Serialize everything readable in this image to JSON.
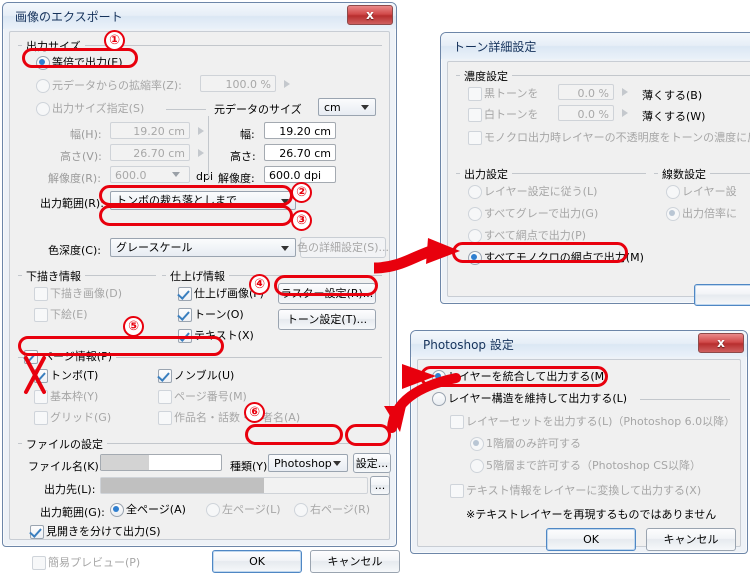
{
  "colors": {
    "annotation_red": "#e8000d",
    "title_text": "#15325b",
    "dialog_bg": "#f0f0f0",
    "accent_blue": "#2f7fd0"
  },
  "export_dialog": {
    "title": "画像のエクスポート",
    "close_label": "x",
    "output_size": {
      "group_label": "出力サイズ",
      "radio_actual": "等倍で出力(E)",
      "radio_scale": "元データからの拡縮率(Z):",
      "scale_value": "100.0 %",
      "radio_specify": "出力サイズ指定(S)",
      "width_label": "幅(H):",
      "width_value": "19.20 cm",
      "height_label": "高さ(V):",
      "height_value": "26.70 cm",
      "res_label": "解像度(R):",
      "res_value": "600.0",
      "res_unit": "dpi",
      "source_size_label": "元データのサイズ",
      "unit_value": "cm",
      "src_width_label": "幅:",
      "src_width_value": "19.20 cm",
      "src_height_label": "高さ:",
      "src_height_value": "26.70 cm",
      "src_res_label": "解像度:",
      "src_res_value": "600.0 dpi",
      "range_label": "出力範囲(R):",
      "range_value": "トンボの裁ち落としまで",
      "depth_label": "色深度(C):",
      "depth_value": "グレースケール",
      "color_detail_button": "色の詳細設定(S)..."
    },
    "draft_info": {
      "group_label": "下描き情報",
      "check_draft_image": "下描き画像(D)",
      "check_sketch": "下絵(E)"
    },
    "finish_info": {
      "group_label": "仕上げ情報",
      "check_finish_image": "仕上げ画像(F)",
      "check_tone": "トーン(O)",
      "check_text": "テキスト(X)",
      "raster_button": "ラスター設定(R)...",
      "tone_button": "トーン設定(T)..."
    },
    "page_info": {
      "group_label": "ページ情報(P)",
      "check_tombo": "トンボ(T)",
      "check_nonbre": "ノンブル(U)",
      "check_basic_frame": "基本枠(Y)",
      "check_page_number": "ページ番号(M)",
      "check_grid": "グリッド(G)",
      "check_title_author": "作品名・話数・作者名(A)"
    },
    "file_settings": {
      "group_label": "ファイルの設定",
      "filename_label": "ファイル名(K):",
      "filename_value": "",
      "type_label": "種類(Y):",
      "type_value": "Photoshop",
      "settings_button": "設定...",
      "dest_label": "出力先(L):",
      "dest_value": "",
      "browse_button": "...",
      "range_label": "出力範囲(G):",
      "radio_all_pages": "全ページ(A)",
      "radio_left_page": "左ページ(L)",
      "radio_right_page": "右ページ(R)",
      "check_split_spread": "見開きを分けて出力(S)"
    },
    "footer": {
      "check_simple_preview": "簡易プレビュー(P)",
      "ok_button": "OK",
      "cancel_button": "キャンセル"
    }
  },
  "tone_dialog": {
    "title": "トーン詳細設定",
    "density": {
      "group_label": "濃度設定",
      "check_black_tone": "黒トーンを",
      "black_value": "0.0 %",
      "black_suffix": "薄くする(B)",
      "check_white_tone": "白トーンを",
      "white_value": "0.0 %",
      "white_suffix": "薄くする(W)",
      "check_mono_opacity": "モノクロ出力時レイヤーの不透明度をトーンの濃度に反映"
    },
    "output": {
      "group_label": "出力設定",
      "radio_follow_layer": "レイヤー設定に従う(L)",
      "radio_all_gray": "すべてグレーで出力(G)",
      "radio_all_halftone": "すべて網点で出力(P)",
      "radio_all_mono_halftone": "すべてモノクロの網点で出力(M)"
    },
    "lines": {
      "group_label": "線数設定",
      "radio_layer_setting": "レイヤー設",
      "radio_output_scale": "出力倍率に"
    }
  },
  "photoshop_dialog": {
    "title": "Photoshop 設定",
    "close_label": "x",
    "radio_merge_layers": "レイヤーを統合して出力する(M)",
    "radio_keep_structure": "レイヤー構造を維持して出力する(L)",
    "check_layer_sets": "レイヤーセットを出力する(L)（Photoshop 6.0以降）",
    "radio_one_level": "1階層のみ許可する",
    "radio_five_levels": "5階層まで許可する（Photoshop CS以降）",
    "check_text_to_layer": "テキスト情報をレイヤーに変換して出力する(X)",
    "note": "※テキストレイヤーを再現するものではありません",
    "ok_button": "OK",
    "cancel_button": "キャンセル"
  },
  "annotations": {
    "marker_1": "①",
    "marker_2": "②",
    "marker_3": "③",
    "marker_4": "④",
    "marker_5": "⑤",
    "marker_6": "⑥"
  }
}
